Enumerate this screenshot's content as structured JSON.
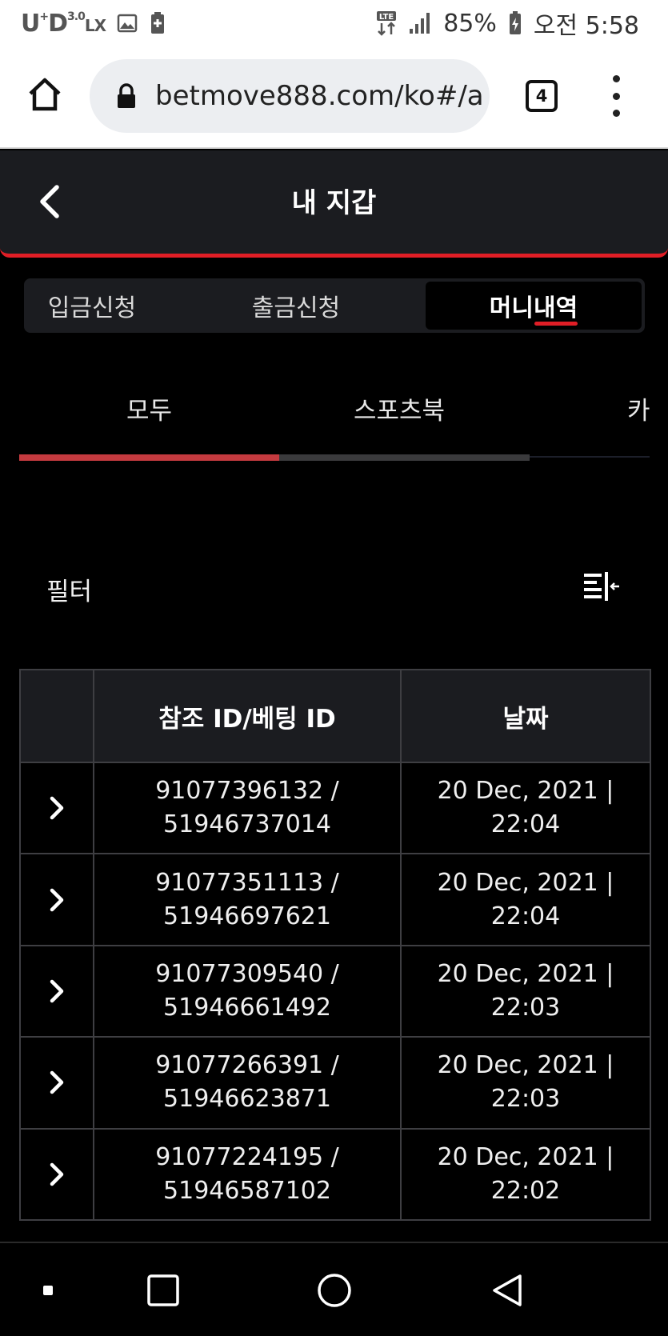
{
  "status_bar": {
    "carrier": "U",
    "carrier_sup": "+",
    "network": "D",
    "network_suffix": "LX",
    "network_gen": "3.0",
    "battery": "85%",
    "time": "오전 5:58"
  },
  "browser": {
    "url": "betmove888.com/ko#/a",
    "tab_count": "4"
  },
  "header": {
    "title": "내 지갑"
  },
  "segment_tabs": [
    {
      "label": "입금신청"
    },
    {
      "label": "출금신청"
    },
    {
      "label": "머니내역",
      "active": true
    }
  ],
  "sub_tabs": [
    {
      "label": "모두",
      "active": true
    },
    {
      "label": "스포츠북"
    },
    {
      "label": "카"
    }
  ],
  "filter": {
    "label": "필터"
  },
  "table": {
    "columns": [
      "",
      "참조 ID/베팅 ID",
      "날짜"
    ],
    "rows": [
      {
        "ref_id": "91077396132 /",
        "bet_id": "51946737014",
        "date": "20 Dec, 2021 |",
        "time": "22:04"
      },
      {
        "ref_id": "91077351113 /",
        "bet_id": "51946697621",
        "date": "20 Dec, 2021 |",
        "time": "22:04"
      },
      {
        "ref_id": "91077309540 /",
        "bet_id": "51946661492",
        "date": "20 Dec, 2021 |",
        "time": "22:03"
      },
      {
        "ref_id": "91077266391 /",
        "bet_id": "51946623871",
        "date": "20 Dec, 2021 |",
        "time": "22:03"
      },
      {
        "ref_id": "91077224195 /",
        "bet_id": "51946587102",
        "date": "20 Dec, 2021 |",
        "time": "22:02"
      }
    ]
  },
  "colors": {
    "accent": "#e01e26",
    "header_bg": "#1b1c20",
    "page_bg": "#000000",
    "subtab_active": "#c43a3f"
  },
  "icons": {
    "home": "home-icon",
    "lock": "lock-icon",
    "menu": "more-vertical-icon",
    "back": "chevron-left-icon",
    "filter": "filter-collapse-icon",
    "row_expand": "chevron-right-icon",
    "nav_recent": "square-dot-icon",
    "nav_home": "circle-icon",
    "nav_overview": "square-icon",
    "nav_back": "triangle-back-icon"
  }
}
